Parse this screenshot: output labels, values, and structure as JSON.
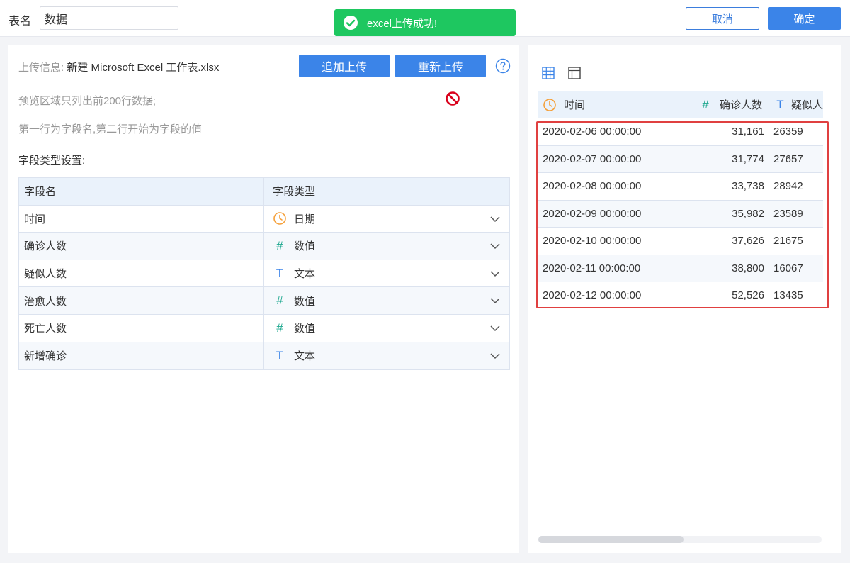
{
  "header": {
    "table_name_label": "表名",
    "table_name_value": "数据",
    "toast_message": "excel上传成功!",
    "cancel_label": "取消",
    "confirm_label": "确定"
  },
  "upload": {
    "info_label": "上传信息:",
    "file_name": "新建 Microsoft Excel 工作表.xlsx",
    "append_label": "追加上传",
    "reupload_label": "重新上传",
    "note1": "预览区域只列出前200行数据;",
    "note2": "第一行为字段名,第二行开始为字段的值",
    "section_title": "字段类型设置:"
  },
  "field_table": {
    "headers": [
      "字段名",
      "字段类型"
    ],
    "rows": [
      {
        "name": "时间",
        "type": "日期",
        "icon": "clock-icon"
      },
      {
        "name": "确诊人数",
        "type": "数值",
        "icon": "hash-icon"
      },
      {
        "name": "疑似人数",
        "type": "文本",
        "icon": "text-t-icon"
      },
      {
        "name": "治愈人数",
        "type": "数值",
        "icon": "hash-icon"
      },
      {
        "name": "死亡人数",
        "type": "数值",
        "icon": "hash-icon"
      },
      {
        "name": "新增确诊",
        "type": "文本",
        "icon": "text-t-icon"
      }
    ]
  },
  "preview": {
    "headers": [
      "时间",
      "确诊人数",
      "疑似人"
    ],
    "rows": [
      [
        "2020-02-06 00:00:00",
        "31,161",
        "26359"
      ],
      [
        "2020-02-07 00:00:00",
        "31,774",
        "27657"
      ],
      [
        "2020-02-08 00:00:00",
        "33,738",
        "28942"
      ],
      [
        "2020-02-09 00:00:00",
        "35,982",
        "23589"
      ],
      [
        "2020-02-10 00:00:00",
        "37,626",
        "21675"
      ],
      [
        "2020-02-11 00:00:00",
        "38,800",
        "16067"
      ],
      [
        "2020-02-12 00:00:00",
        "52,526",
        "13435"
      ]
    ]
  },
  "colors": {
    "primary": "#3b84e8",
    "success": "#1ec760",
    "date_icon": "#f5a03a",
    "number_icon": "#1ea88f",
    "highlight": "#e04040"
  }
}
